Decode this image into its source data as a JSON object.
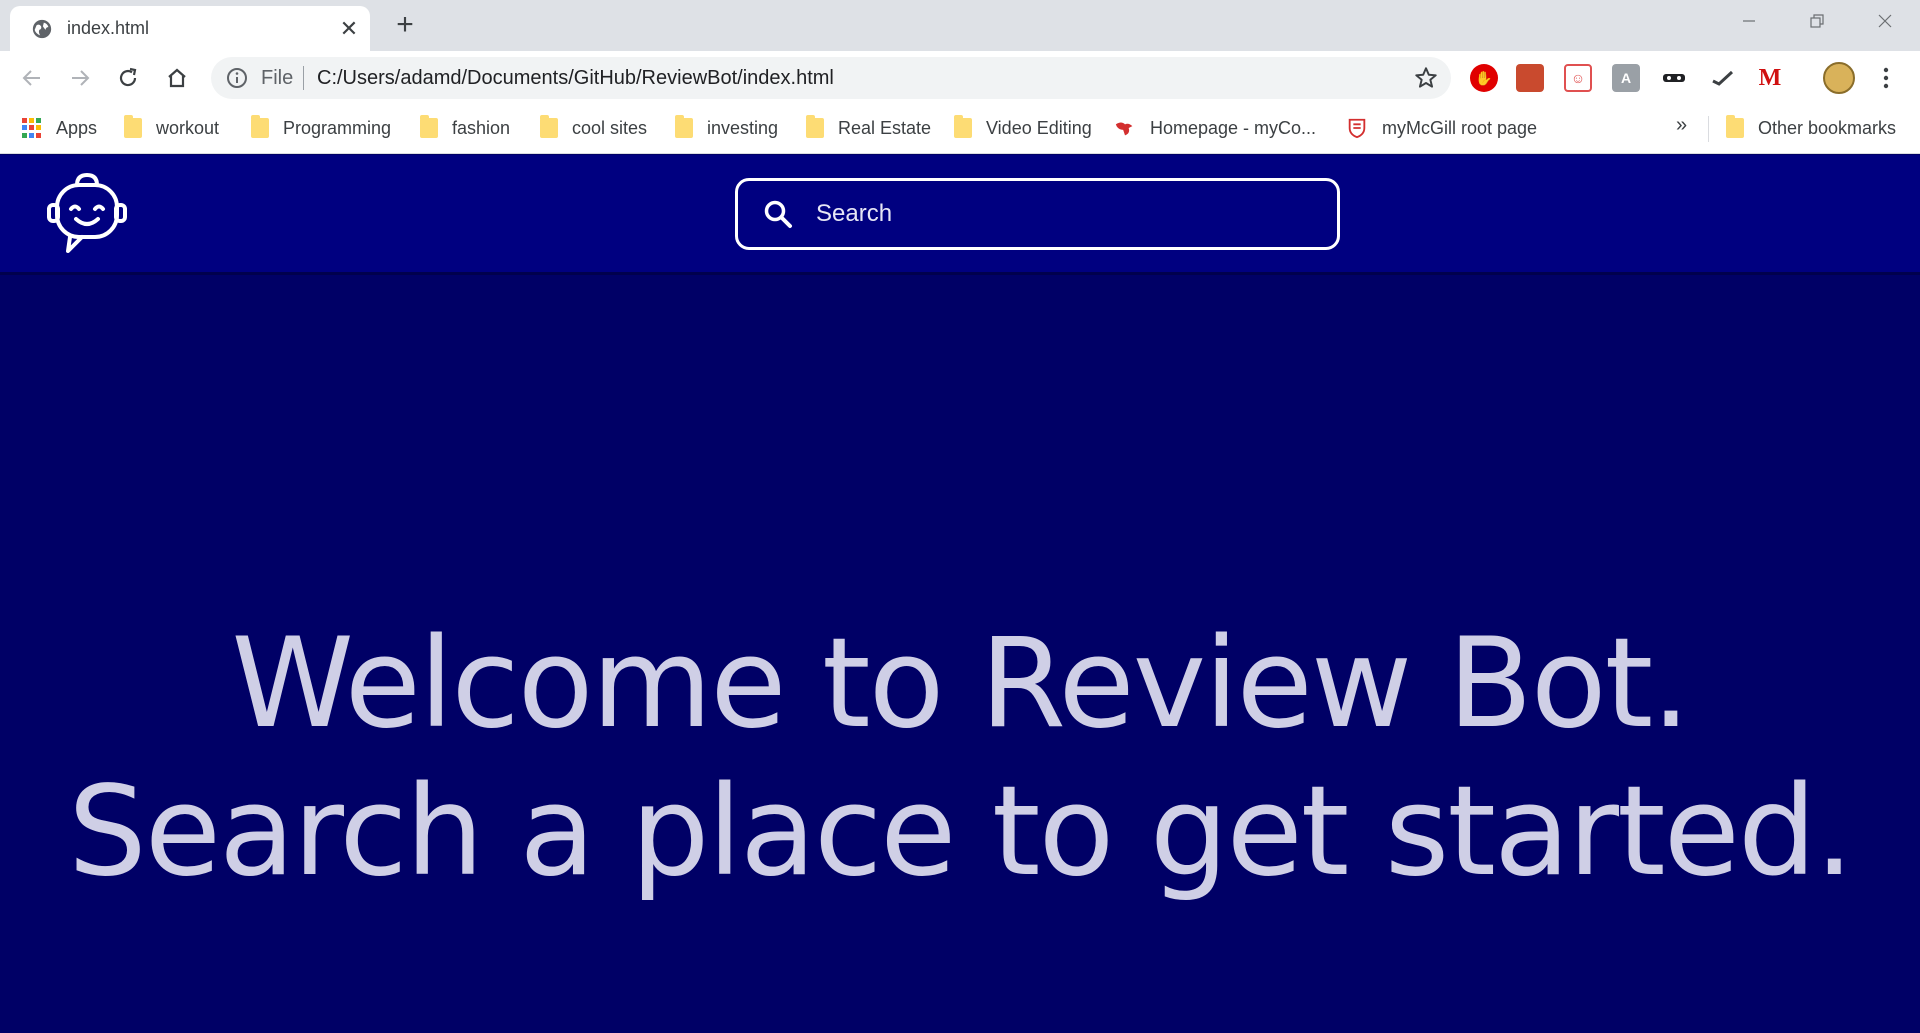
{
  "browser": {
    "tab_title": "index.html",
    "new_tab_symbol": "+",
    "close_symbol": "✕",
    "address": {
      "scheme_label": "File",
      "url": "C:/Users/adamd/Documents/GitHub/ReviewBot/index.html"
    },
    "extensions": [
      "adblock-icon",
      "bookmark-red-icon",
      "pocket-icon",
      "extension-gray-icon",
      "incognito-icon",
      "checkmark-icon",
      "gmail-icon",
      "profile-avatar"
    ],
    "bookmarks": [
      {
        "label": "Apps",
        "icon": "apps-icon"
      },
      {
        "label": "workout",
        "icon": "folder-icon"
      },
      {
        "label": "Programming",
        "icon": "folder-icon"
      },
      {
        "label": "fashion",
        "icon": "folder-icon"
      },
      {
        "label": "cool sites",
        "icon": "folder-icon"
      },
      {
        "label": "investing",
        "icon": "folder-icon"
      },
      {
        "label": "Real Estate",
        "icon": "folder-icon"
      },
      {
        "label": "Video Editing",
        "icon": "folder-icon"
      },
      {
        "label": "Homepage - myCo...",
        "icon": "red-bird-icon"
      },
      {
        "label": "myMcGill root page",
        "icon": "mcgill-crest-icon"
      }
    ],
    "bookmarks_overflow": "»",
    "other_bookmarks": "Other bookmarks"
  },
  "page": {
    "search": {
      "placeholder": "Search"
    },
    "hero": {
      "line1": "Welcome to Review Bot.",
      "line2": "Search a place to get started."
    }
  },
  "colors": {
    "header_bg": "#000080",
    "page_bg": "#000066",
    "hero_text": "#cfcfe6"
  }
}
